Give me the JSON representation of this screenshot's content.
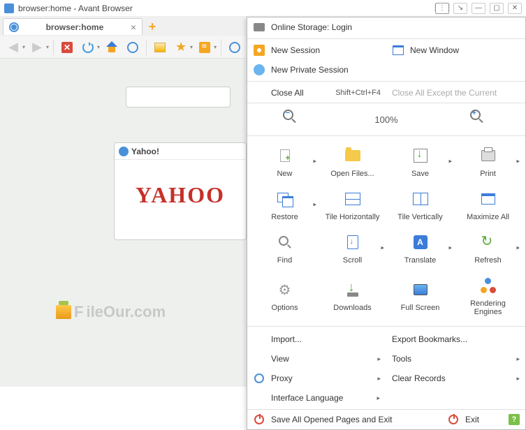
{
  "window": {
    "title": "browser:home - Avant Browser"
  },
  "tab": {
    "title": "browser:home"
  },
  "content": {
    "yahoo_title": "Yahoo!",
    "yahoo_logo": "YAHOO",
    "watermark_prefix": "F",
    "watermark_rest": "ileOur.com"
  },
  "menu": {
    "online_storage": "Online Storage: Login",
    "new_session": "New Session",
    "new_window": "New Window",
    "new_private": "New Private Session",
    "close_all": "Close All",
    "close_all_shortcut": "Shift+Ctrl+F4",
    "close_all_except": "Close All Except the Current",
    "zoom": "100%",
    "grid": {
      "new": "New",
      "open_files": "Open Files...",
      "save": "Save",
      "print": "Print",
      "restore": "Restore",
      "tile_h": "Tile Horizontally",
      "tile_v": "Tile Vertically",
      "maximize": "Maximize All",
      "find": "Find",
      "scroll": "Scroll",
      "translate": "Translate",
      "refresh": "Refresh",
      "options": "Options",
      "downloads": "Downloads",
      "full_screen": "Full Screen",
      "engines": "Rendering Engines"
    },
    "list": {
      "import": "Import...",
      "export_bookmarks": "Export Bookmarks...",
      "view": "View",
      "tools": "Tools",
      "proxy": "Proxy",
      "clear_records": "Clear Records",
      "interface_lang": "Interface Language"
    },
    "footer": {
      "save_exit": "Save All Opened Pages and Exit",
      "exit": "Exit"
    }
  }
}
